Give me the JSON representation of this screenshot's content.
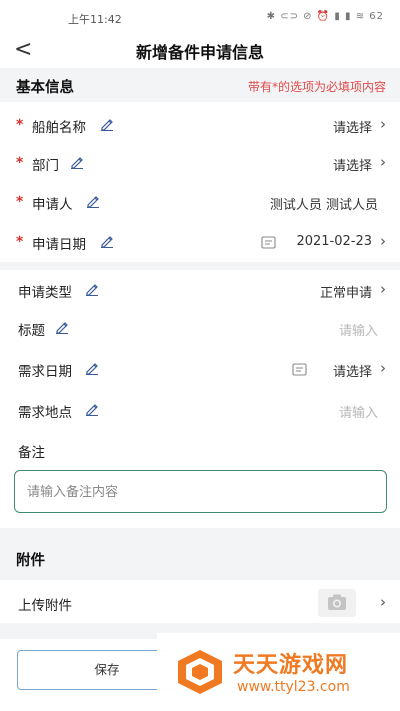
{
  "status_bar": {
    "time": "上午11:42",
    "icons": "✱ ⊂⊃ ⊘ ⏰ ▮ ▮ ≋ 62"
  },
  "nav": {
    "back_glyph": "<",
    "title": "新增备件申请信息"
  },
  "basic_section": {
    "title": "基本信息",
    "required_note": "带有*的选项为必填项内容"
  },
  "required_fields": [
    {
      "label": "船舶名称",
      "value": "请选择",
      "required_mark": "*"
    },
    {
      "label": "部门",
      "value": "请选择",
      "required_mark": "*"
    },
    {
      "label": "申请人",
      "value": "测试人员 测试人员",
      "required_mark": "*"
    },
    {
      "label": "申请日期",
      "value": "2021-02-23",
      "required_mark": "*"
    }
  ],
  "optional_fields": [
    {
      "label": "申请类型",
      "value": "正常申请"
    },
    {
      "label": "标题",
      "placeholder": "请输入"
    },
    {
      "label": "需求日期",
      "value": "请选择"
    },
    {
      "label": "需求地点",
      "placeholder": "请输入"
    }
  ],
  "remark": {
    "label": "备注",
    "placeholder": "请输入备注内容"
  },
  "attachment_section": {
    "title": "附件",
    "upload_label": "上传附件"
  },
  "footer": {
    "save_label": "保存"
  },
  "watermark": {
    "text": "天天游戏网",
    "url": "www.ttyl23.com"
  },
  "colors": {
    "required": "#d9302c",
    "accent_green": "#3f8a6c",
    "icon_blue": "#3a5a9a",
    "watermark": "#f07a22"
  },
  "icons": [
    "back-arrow-icon",
    "pencil-icon",
    "calendar-icon",
    "chevron-right-icon",
    "camera-icon"
  ]
}
